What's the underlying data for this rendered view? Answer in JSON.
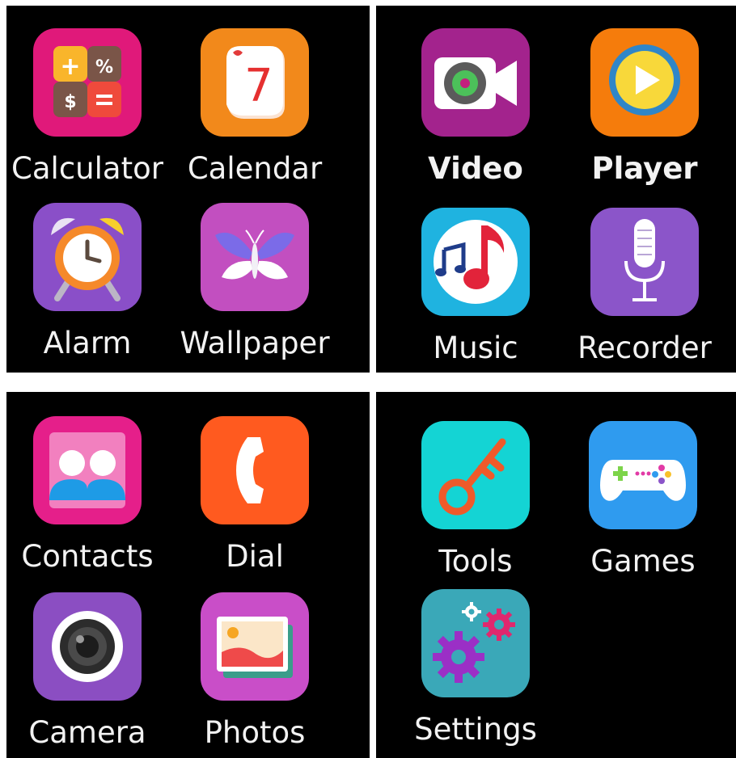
{
  "screens": [
    {
      "apps": [
        {
          "label": "Calculator",
          "icon": "calculator-icon"
        },
        {
          "label": "Calendar",
          "icon": "calendar-icon",
          "day": "7"
        },
        {
          "label": "Alarm",
          "icon": "alarm-clock-icon"
        },
        {
          "label": "Wallpaper",
          "icon": "butterfly-icon"
        }
      ]
    },
    {
      "apps": [
        {
          "label": "Video",
          "icon": "video-camera-icon"
        },
        {
          "label": "Player",
          "icon": "play-icon"
        },
        {
          "label": "Music",
          "icon": "music-note-icon"
        },
        {
          "label": "Recorder",
          "icon": "microphone-icon"
        }
      ]
    },
    {
      "apps": [
        {
          "label": "Contacts",
          "icon": "contacts-icon"
        },
        {
          "label": "Dial",
          "icon": "phone-handset-icon"
        },
        {
          "label": "Camera",
          "icon": "camera-lens-icon"
        },
        {
          "label": "Photos",
          "icon": "photos-icon"
        }
      ]
    },
    {
      "apps": [
        {
          "label": "Tools",
          "icon": "key-icon"
        },
        {
          "label": "Games",
          "icon": "gamepad-icon"
        },
        {
          "label": "Settings",
          "icon": "gears-icon"
        }
      ]
    }
  ],
  "colors": {
    "background": "#000000",
    "calculator": "#e0197a",
    "calendar": "#f2891b",
    "alarm": "#8a4fc8",
    "wallpaper": "#c24fc0",
    "video": "#a3238d",
    "player": "#f57c0c",
    "music": "#1fb3e0",
    "recorder": "#8b55c9",
    "contacts": "#e51f8a",
    "dial": "#ff5a1f",
    "camera": "#8b4ec2",
    "photos": "#c94ec8",
    "tools": "#14d4d4",
    "games": "#2f9bef",
    "settings": "#3aa8b8"
  }
}
